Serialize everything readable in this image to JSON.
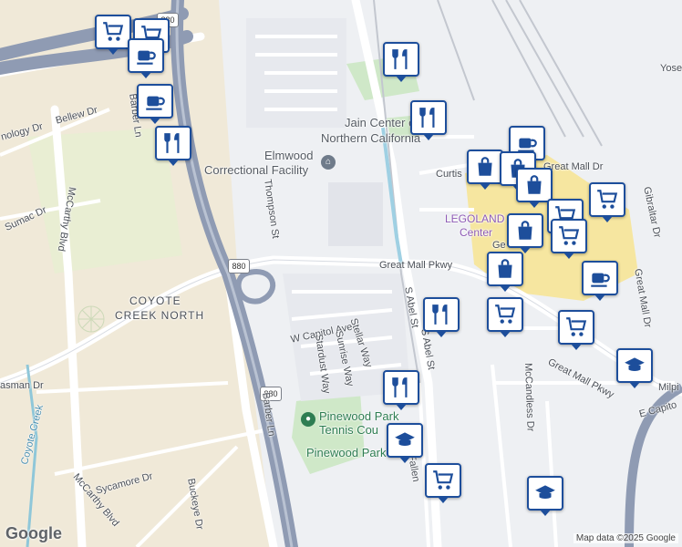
{
  "map": {
    "attribution": "Map data ©2025 Google",
    "logo": "Google",
    "colors": {
      "pin_border": "#1d4e9b",
      "pin_icon": "#1d4e9b",
      "freeway": "#8f9bb3",
      "land_tan": "#f0e9d8",
      "park_green": "#cfe8c8",
      "mall_yellow": "#f6e6a0"
    }
  },
  "labels": {
    "coyote_creek_north_1": "COYOTE",
    "coyote_creek_north_2": "CREEK NORTH",
    "elmwood_1": "Elmwood",
    "elmwood_2": "Correctional Facility",
    "jain_1": "Jain Center of",
    "jain_2": "Northern California",
    "legoland_1": "LEGOLAND",
    "legoland_2": "Center",
    "pinewood_tennis_1": "Pinewood Park",
    "pinewood_tennis_2": "Tennis Cou",
    "pinewood_park": "Pinewood Park",
    "great_mall_pkwy": "Great Mall Pkwy",
    "great_mall_pkwy_2": "Great Mall Pkwy",
    "w_capitol_ave": "W Capitol Ave",
    "e_capitol": "E Capito",
    "s_abel_st_1": "S Abel St",
    "s_abel_st_2": "S Abel St",
    "stellar_way": "Stellar Way",
    "sunrise_way": "Sunrise Way",
    "stardust_way": "Stardust Way",
    "thompson_st": "Thompson St",
    "barber_ln_1": "Barber Ln",
    "barber_ln_2": "Barber Ln",
    "bellew_dr": "Bellew Dr",
    "technology_dr": "nology Dr",
    "sumac_dr": "Sumac Dr",
    "mccarthy_blvd_1": "McCarthy Blvd",
    "mccarthy_blvd_2": "McCarthy Blvd",
    "tasman_dr": "asman Dr",
    "coyote_creek": "Coyote Creek",
    "sycamore_dr": "Sycamore Dr",
    "buckeye_dr": "Buckeye Dr",
    "curtis": "Curtis",
    "great_mall_dr_1": "Great Mall Dr",
    "great_mall_dr_2": "Great Mall Dr",
    "gibraltar_dr": "Gibraltar Dr",
    "mccandless_dr": "McCandless Dr",
    "yose": "Yose",
    "milpi": "Milpi",
    "fallen": "Fallen",
    "ge": "Ge",
    "shield_880_a": "880",
    "shield_880_b": "880",
    "shield_880_c": "880"
  },
  "pins": [
    {
      "id": "pin-1",
      "icon": "cart-icon"
    },
    {
      "id": "pin-2",
      "icon": "cart-icon"
    },
    {
      "id": "pin-3",
      "icon": "coffee-icon"
    },
    {
      "id": "pin-4",
      "icon": "coffee-icon"
    },
    {
      "id": "pin-5",
      "icon": "restaurant-icon"
    },
    {
      "id": "pin-6",
      "icon": "restaurant-icon"
    },
    {
      "id": "pin-7",
      "icon": "restaurant-icon"
    },
    {
      "id": "pin-8",
      "icon": "coffee-icon"
    },
    {
      "id": "pin-9",
      "icon": "shopping-bag-icon"
    },
    {
      "id": "pin-10",
      "icon": "shopping-bag-icon"
    },
    {
      "id": "pin-11",
      "icon": "shopping-bag-icon"
    },
    {
      "id": "pin-12",
      "icon": "cart-icon"
    },
    {
      "id": "pin-13",
      "icon": "cart-icon"
    },
    {
      "id": "pin-14",
      "icon": "shopping-bag-icon"
    },
    {
      "id": "pin-15",
      "icon": "cart-icon"
    },
    {
      "id": "pin-16",
      "icon": "shopping-bag-icon"
    },
    {
      "id": "pin-17",
      "icon": "coffee-icon"
    },
    {
      "id": "pin-18",
      "icon": "restaurant-icon"
    },
    {
      "id": "pin-19",
      "icon": "cart-icon"
    },
    {
      "id": "pin-20",
      "icon": "cart-icon"
    },
    {
      "id": "pin-21",
      "icon": "school-icon"
    },
    {
      "id": "pin-22",
      "icon": "restaurant-icon"
    },
    {
      "id": "pin-23",
      "icon": "school-icon"
    },
    {
      "id": "pin-24",
      "icon": "cart-icon"
    },
    {
      "id": "pin-25",
      "icon": "school-icon"
    }
  ]
}
